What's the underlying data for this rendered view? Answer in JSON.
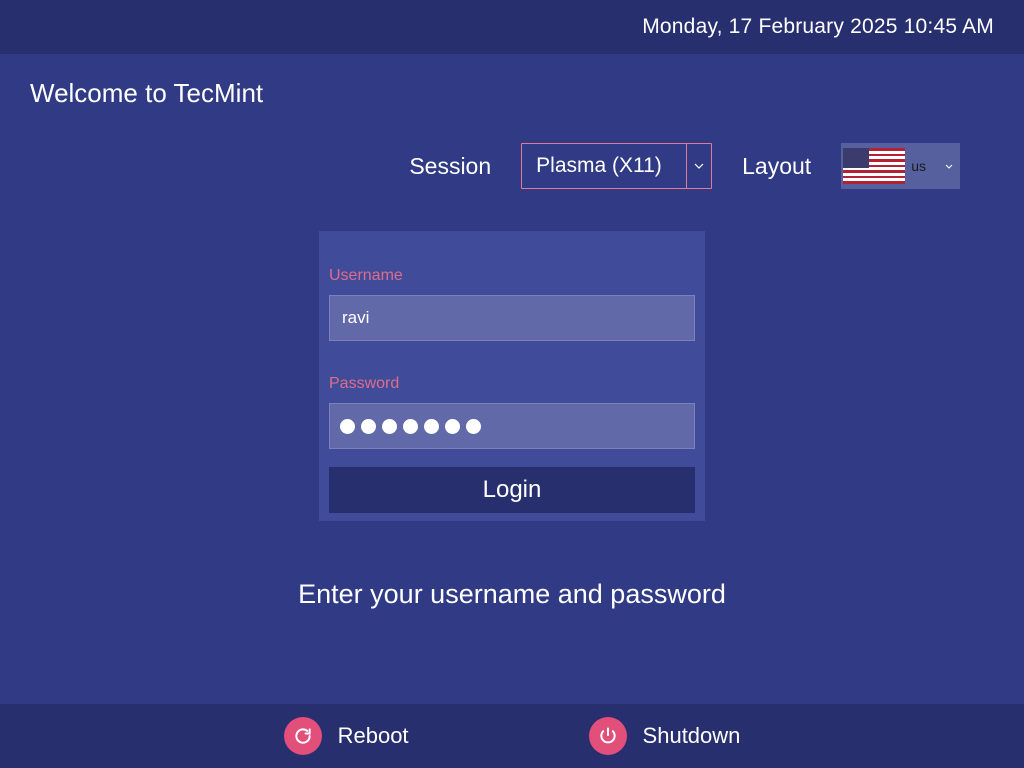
{
  "topbar": {
    "datetime": "Monday, 17 February 2025  10:45 AM"
  },
  "header": {
    "welcome": "Welcome to TecMint"
  },
  "session": {
    "label": "Session",
    "value": "Plasma (X11)"
  },
  "layout": {
    "label": "Layout",
    "code": "us",
    "flag": "us-flag"
  },
  "login": {
    "username_label": "Username",
    "username_value": "ravi",
    "password_label": "Password",
    "password_dots": 7,
    "button": "Login"
  },
  "instruction": "Enter your username and password",
  "bottombar": {
    "reboot": "Reboot",
    "shutdown": "Shutdown"
  }
}
